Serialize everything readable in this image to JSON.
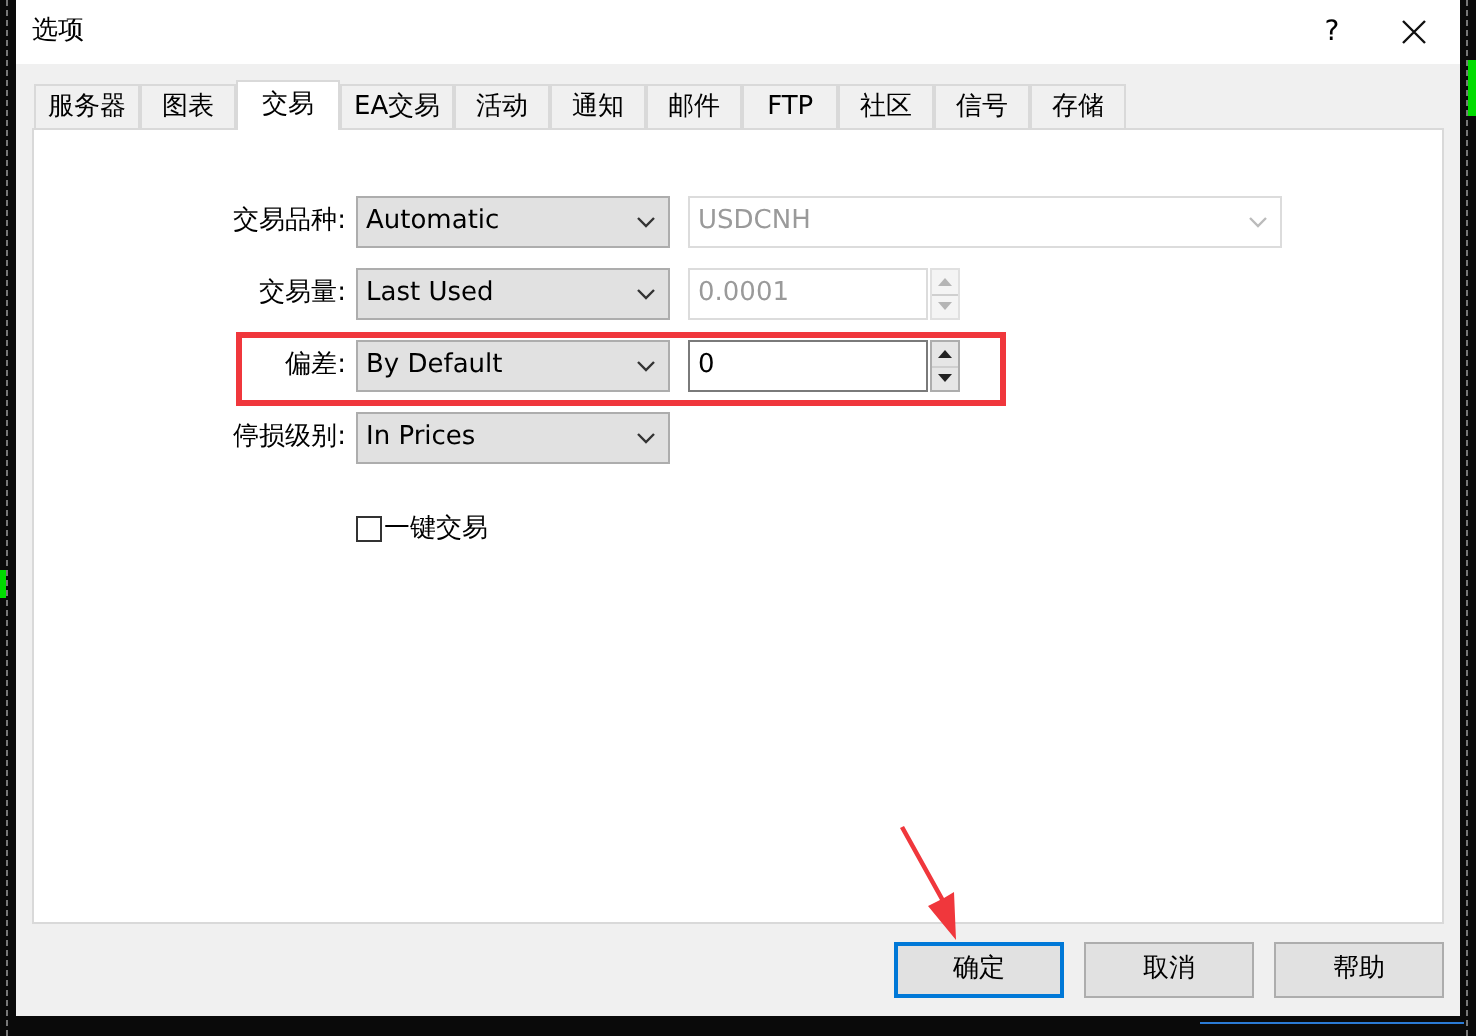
{
  "window": {
    "title": "选项",
    "help": "?"
  },
  "tabs": [
    {
      "label": "服务器",
      "selected": false
    },
    {
      "label": "图表",
      "selected": false
    },
    {
      "label": "交易",
      "selected": true
    },
    {
      "label": "EA交易",
      "selected": false
    },
    {
      "label": "活动",
      "selected": false
    },
    {
      "label": "通知",
      "selected": false
    },
    {
      "label": "邮件",
      "selected": false
    },
    {
      "label": "FTP",
      "selected": false
    },
    {
      "label": "社区",
      "selected": false
    },
    {
      "label": "信号",
      "selected": false
    },
    {
      "label": "存储",
      "selected": false
    }
  ],
  "rows": [
    {
      "label": "交易品种:",
      "value": "Automatic",
      "highlighted": false,
      "extra": {
        "kind": "combo",
        "value": "USDCNH",
        "disabled": true
      }
    },
    {
      "label": "交易量:",
      "value": "Last Used",
      "highlighted": false,
      "extra": {
        "kind": "spin",
        "value": "0.0001",
        "disabled": true
      }
    },
    {
      "label": "偏差:",
      "value": "By Default",
      "highlighted": true,
      "extra": {
        "kind": "spin",
        "value": "0",
        "disabled": false
      }
    },
    {
      "label": "停损级别:",
      "value": "In Prices",
      "highlighted": false
    }
  ],
  "one_click": {
    "label": "一键交易",
    "checked": false
  },
  "buttons": [
    {
      "label": "确定",
      "default": true
    },
    {
      "label": "取消",
      "default": false
    },
    {
      "label": "帮助",
      "default": false
    }
  ]
}
